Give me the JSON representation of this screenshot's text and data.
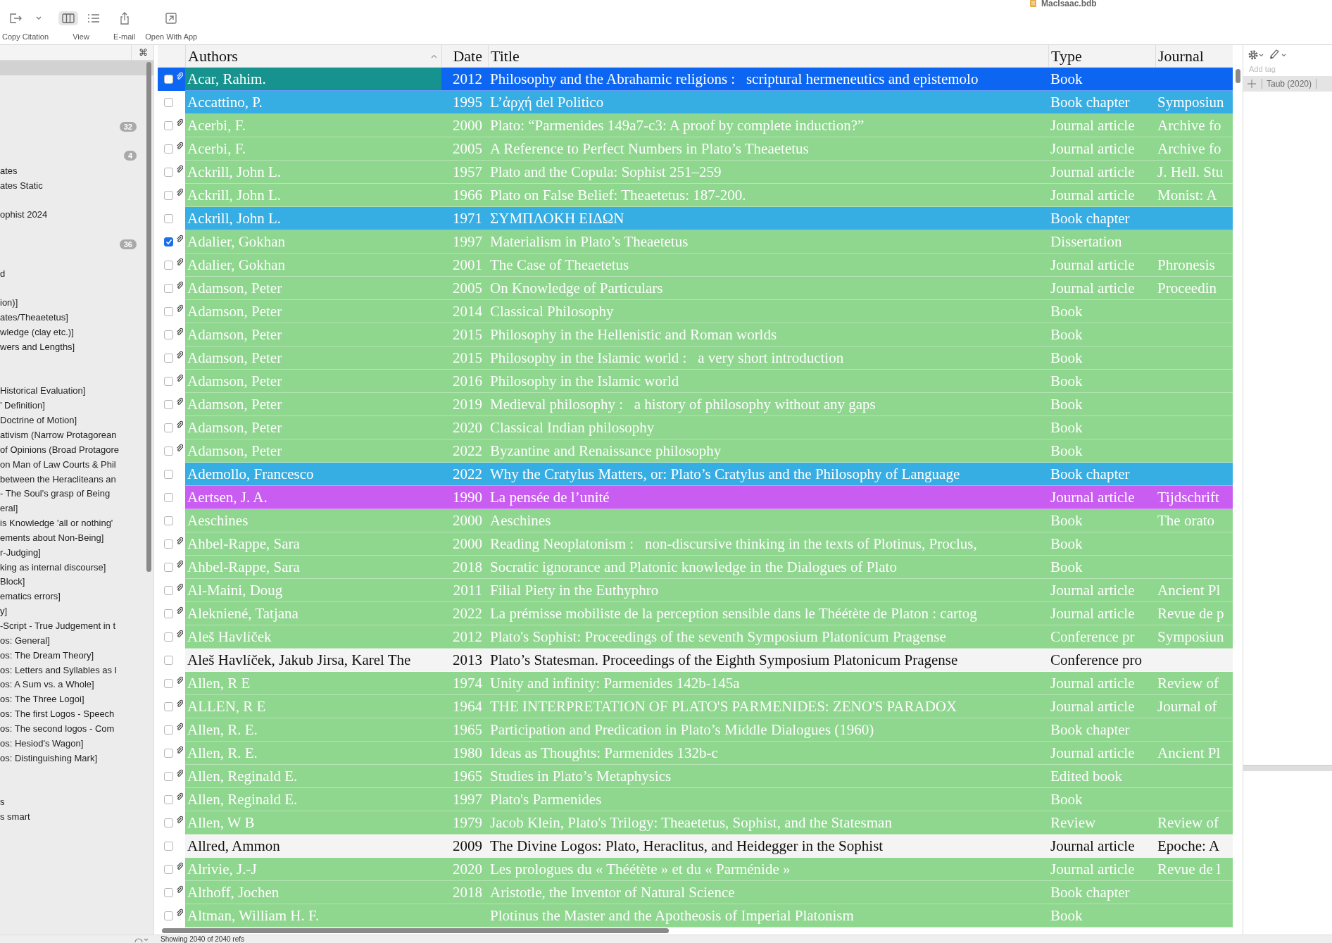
{
  "window": {
    "title": "MacIsaac.bdb"
  },
  "toolbar": [
    {
      "label": "Copy Citation",
      "icons": [
        {
          "kind": "export",
          "selected": false
        },
        {
          "kind": "chevron",
          "selected": false
        }
      ]
    },
    {
      "label": "View",
      "icons": [
        {
          "kind": "columns",
          "selected": true
        },
        {
          "kind": "list",
          "selected": false
        }
      ]
    },
    {
      "label": "E-mail",
      "icons": [
        {
          "kind": "share",
          "selected": false
        }
      ]
    },
    {
      "label": "Open With App",
      "icons": [
        {
          "kind": "external",
          "selected": false
        }
      ]
    }
  ],
  "sidebar": {
    "shortcut": "⌘",
    "items": [
      {
        "selected": true
      },
      {
        "selected": false
      },
      {
        "selected": false
      },
      {
        "selected": false
      },
      {
        "selected": false,
        "badge": "32"
      },
      {
        "selected": false
      },
      {
        "selected": false,
        "badge": "4"
      },
      {
        "selected": false,
        "label": "ates"
      },
      {
        "selected": false,
        "label": "ates Static"
      },
      {
        "selected": false
      },
      {
        "selected": false,
        "label": "ophist 2024"
      },
      {
        "selected": false
      },
      {
        "selected": false,
        "badge": "36"
      },
      {
        "selected": false
      },
      {
        "selected": false,
        "label": "d"
      },
      {
        "selected": false
      },
      {
        "selected": false,
        "label": "ion)]"
      },
      {
        "selected": false,
        "label": "ates/Theaetetus]"
      },
      {
        "selected": false,
        "label": "wledge (clay etc.)]"
      },
      {
        "selected": false,
        "label": "wers and Lengths]"
      },
      {
        "selected": false
      },
      {
        "selected": false
      },
      {
        "selected": false,
        "label": "Historical Evaluation]"
      },
      {
        "selected": false,
        "label": "’ Definition]"
      },
      {
        "selected": false,
        "label": "Doctrine of Motion]"
      },
      {
        "selected": false,
        "label": "ativism (Narrow Protagorean"
      },
      {
        "selected": false,
        "label": "of Opinions (Broad Protagore"
      },
      {
        "selected": false,
        "label": "on Man of Law Courts & Phil"
      },
      {
        "selected": false,
        "label": "between the Heracliteans an"
      },
      {
        "selected": false,
        "label": "- The Soul's grasp of Being"
      },
      {
        "selected": false,
        "label": "eral]"
      },
      {
        "selected": false,
        "label": "is Knowledge 'all or nothing'"
      },
      {
        "selected": false,
        "label": "ements about Non-Being]"
      },
      {
        "selected": false,
        "label": "r-Judging]"
      },
      {
        "selected": false,
        "label": "king as internal discourse]"
      },
      {
        "selected": false,
        "label": "Block]"
      },
      {
        "selected": false,
        "label": "ematics errors]"
      },
      {
        "selected": false,
        "label": "y]"
      },
      {
        "selected": false,
        "label": "-Script - True Judgement in t"
      },
      {
        "selected": false,
        "label": "os: General]"
      },
      {
        "selected": false,
        "label": "os: The Dream Theory]"
      },
      {
        "selected": false,
        "label": "os: Letters and Syllables as I"
      },
      {
        "selected": false,
        "label": "os: A Sum vs. a Whole]"
      },
      {
        "selected": false,
        "label": "os: The Three Logoi]"
      },
      {
        "selected": false,
        "label": "os: The first Logos - Speech"
      },
      {
        "selected": false,
        "label": "os: The second logos - Com"
      },
      {
        "selected": false,
        "label": "os: Hesiod's Wagon]"
      },
      {
        "selected": false,
        "label": "os: Distinguishing Mark]"
      },
      {
        "selected": false
      },
      {
        "selected": false
      },
      {
        "selected": false,
        "label": "s"
      },
      {
        "selected": false,
        "label": "s smart"
      }
    ]
  },
  "table": {
    "columns": [
      {
        "label": "Authors",
        "sorted": true
      },
      {
        "label": "Date",
        "sorted": false
      },
      {
        "label": "Title",
        "sorted": false
      },
      {
        "label": "Type",
        "sorted": false
      },
      {
        "label": "Journal",
        "sorted": false
      }
    ],
    "rows": [
      {
        "selected": true,
        "checked": false,
        "attachment": true,
        "color": "#16928f",
        "authors": "Acar, Rahim.",
        "date": "2012",
        "title": "Philosophy and the Abrahamic religions :   scriptural hermeneutics and epistemolo",
        "type": "Book"
      },
      {
        "selected": false,
        "checked": false,
        "attachment": false,
        "color": "#36ade3",
        "authors": "Accattino, P.",
        "date": "1995",
        "title": "L’ἀρχή del Politico",
        "type": "Book chapter",
        "journal": "Symposiun"
      },
      {
        "selected": false,
        "checked": false,
        "attachment": true,
        "color": "#8fd68f",
        "authors": "Acerbi, F.",
        "date": "2000",
        "title": "Plato: “Parmenides 149a7-c3: A proof by complete induction?”",
        "type": "Journal article",
        "journal": "Archive fo"
      },
      {
        "selected": false,
        "checked": false,
        "attachment": true,
        "color": "#8fd68f",
        "authors": "Acerbi, F.",
        "date": "2005",
        "title": "A Reference to Perfect Numbers in Plato’s Theaetetus",
        "type": "Journal article",
        "journal": "Archive fo"
      },
      {
        "selected": false,
        "checked": false,
        "attachment": true,
        "color": "#8fd68f",
        "authors": "Ackrill, John L.",
        "date": "1957",
        "title": "Plato and the Copula: Sophist 251–259",
        "type": "Journal article",
        "journal": "J. Hell. Stu"
      },
      {
        "selected": false,
        "checked": false,
        "attachment": true,
        "color": "#8fd68f",
        "authors": "Ackrill, John L.",
        "date": "1966",
        "title": "Plato on False Belief: Theaetetus: 187-200.",
        "type": "Journal article",
        "journal": "Monist: A"
      },
      {
        "selected": false,
        "checked": false,
        "attachment": false,
        "color": "#36ade3",
        "authors": "Ackrill, John L.",
        "date": "1971",
        "title": "ΣΥΜΠΛΟΚΗ ΕΙΔΩΝ",
        "type": "Book chapter"
      },
      {
        "selected": false,
        "checked": true,
        "attachment": true,
        "color": "#8fd68f",
        "authors": "Adalier, Gokhan",
        "date": "1997",
        "title": "Materialism in Plato’s Theaetetus",
        "type": "Dissertation"
      },
      {
        "selected": false,
        "checked": false,
        "attachment": true,
        "color": "#8fd68f",
        "authors": "Adalier, Gokhan",
        "date": "2001",
        "title": "The Case of Theaetetus",
        "type": "Journal article",
        "journal": "Phronesis"
      },
      {
        "selected": false,
        "checked": false,
        "attachment": true,
        "color": "#8fd68f",
        "authors": "Adamson, Peter",
        "date": "2005",
        "title": "On Knowledge of Particulars",
        "type": "Journal article",
        "journal": "Proceedin"
      },
      {
        "selected": false,
        "checked": false,
        "attachment": true,
        "color": "#8fd68f",
        "authors": "Adamson, Peter",
        "date": "2014",
        "title": "Classical Philosophy",
        "type": "Book"
      },
      {
        "selected": false,
        "checked": false,
        "attachment": true,
        "color": "#8fd68f",
        "authors": "Adamson, Peter",
        "date": "2015",
        "title": "Philosophy in the Hellenistic and Roman worlds",
        "type": "Book"
      },
      {
        "selected": false,
        "checked": false,
        "attachment": true,
        "color": "#8fd68f",
        "authors": "Adamson, Peter",
        "date": "2015",
        "title": "Philosophy in the Islamic world :   a very short introduction",
        "type": "Book"
      },
      {
        "selected": false,
        "checked": false,
        "attachment": true,
        "color": "#8fd68f",
        "authors": "Adamson, Peter",
        "date": "2016",
        "title": "Philosophy in the Islamic world",
        "type": "Book"
      },
      {
        "selected": false,
        "checked": false,
        "attachment": true,
        "color": "#8fd68f",
        "authors": "Adamson, Peter",
        "date": "2019",
        "title": "Medieval philosophy :   a history of philosophy without any gaps",
        "type": "Book"
      },
      {
        "selected": false,
        "checked": false,
        "attachment": true,
        "color": "#8fd68f",
        "authors": "Adamson, Peter",
        "date": "2020",
        "title": "Classical Indian philosophy",
        "type": "Book"
      },
      {
        "selected": false,
        "checked": false,
        "attachment": true,
        "color": "#8fd68f",
        "authors": "Adamson, Peter",
        "date": "2022",
        "title": "Byzantine and Renaissance philosophy",
        "type": "Book"
      },
      {
        "selected": false,
        "checked": false,
        "attachment": false,
        "color": "#36ade3",
        "authors": "Ademollo, Francesco",
        "date": "2022",
        "title": "Why the Cratylus Matters, or: Plato’s Cratylus and the Philosophy of Language",
        "type": "Book chapter"
      },
      {
        "selected": false,
        "checked": false,
        "attachment": false,
        "color": "#c95df2",
        "authors": "Aertsen, J. A.",
        "date": "1990",
        "title": "La pensée de l’unité",
        "type": "Journal article",
        "journal": "Tijdschrift"
      },
      {
        "selected": false,
        "checked": false,
        "attachment": false,
        "color": "#8fd68f",
        "authors": "Aeschines",
        "date": "2000",
        "title": "Aeschines",
        "type": "Book",
        "journal": "The orato"
      },
      {
        "selected": false,
        "checked": false,
        "attachment": true,
        "color": "#8fd68f",
        "authors": "Ahbel-Rappe, Sara",
        "date": "2000",
        "title": "Reading Neoplatonism :   non-discursive thinking in the texts of Plotinus, Proclus,",
        "type": "Book"
      },
      {
        "selected": false,
        "checked": false,
        "attachment": true,
        "color": "#8fd68f",
        "authors": "Ahbel-Rappe, Sara",
        "date": "2018",
        "title": "Socratic ignorance and Platonic knowledge in the Dialogues of Plato",
        "type": "Book"
      },
      {
        "selected": false,
        "checked": false,
        "attachment": true,
        "color": "#8fd68f",
        "authors": "Al-Maini, Doug",
        "date": "2011",
        "title": "Filial Piety in the Euthyphro",
        "type": "Journal article",
        "journal": "Ancient Pl"
      },
      {
        "selected": false,
        "checked": false,
        "attachment": true,
        "color": "#8fd68f",
        "authors": "Alekniené, Tatjana",
        "date": "2022",
        "title": "La prémisse mobiliste de la perception sensible dans le Théétète de Platon : cartog",
        "type": "Journal article",
        "journal": "Revue de p"
      },
      {
        "selected": false,
        "checked": false,
        "attachment": true,
        "color": "#8fd68f",
        "authors": "Aleš Havlíček",
        "date": "2012",
        "title": "Plato's Sophist: Proceedings of the seventh Symposium Platonicum Pragense",
        "type": "Conference pr",
        "journal": "Symposiun"
      },
      {
        "selected": false,
        "checked": false,
        "attachment": false,
        "color": "#f4f4f4",
        "authors": "Aleš Havlíček, Jakub Jirsa, Karel The",
        "date": "2013",
        "title": "Plato’s Statesman. Proceedings of the Eighth Symposium Platonicum Pragense",
        "type": "Conference pro"
      },
      {
        "selected": false,
        "checked": false,
        "attachment": true,
        "color": "#8fd68f",
        "authors": "Allen, R E",
        "date": "1974",
        "title": "Unity and infinity: Parmenides 142b-145a",
        "type": "Journal article",
        "journal": "Review of"
      },
      {
        "selected": false,
        "checked": false,
        "attachment": true,
        "color": "#8fd68f",
        "authors": "ALLEN, R E",
        "date": "1964",
        "title": "THE INTERPRETATION OF PLATO'S PARMENIDES: ZENO'S PARADOX",
        "type": "Journal article",
        "journal": "Journal of"
      },
      {
        "selected": false,
        "checked": false,
        "attachment": true,
        "color": "#8fd68f",
        "authors": "Allen, R. E.",
        "date": "1965",
        "title": "Participation and Predication in Plato’s Middle Dialogues (1960)",
        "type": "Book chapter"
      },
      {
        "selected": false,
        "checked": false,
        "attachment": true,
        "color": "#8fd68f",
        "authors": "Allen, R. E.",
        "date": "1980",
        "title": "Ideas as Thoughts: Parmenides 132b-c",
        "type": "Journal article",
        "journal": "Ancient Pl"
      },
      {
        "selected": false,
        "checked": false,
        "attachment": true,
        "color": "#8fd68f",
        "authors": "Allen, Reginald E.",
        "date": "1965",
        "title": "Studies in Plato’s Metaphysics",
        "type": "Edited book"
      },
      {
        "selected": false,
        "checked": false,
        "attachment": true,
        "color": "#8fd68f",
        "authors": "Allen, Reginald E.",
        "date": "1997",
        "title": "Plato's Parmenides",
        "type": "Book"
      },
      {
        "selected": false,
        "checked": false,
        "attachment": true,
        "color": "#8fd68f",
        "authors": "Allen, W B",
        "date": "1979",
        "title": "Jacob Klein, Plato's Trilogy: Theaetetus, Sophist, and the Statesman",
        "type": "Review",
        "journal": "Review of"
      },
      {
        "selected": false,
        "checked": false,
        "attachment": false,
        "color": "#f4f4f4",
        "authors": "Allred, Ammon",
        "date": "2009",
        "title": "The Divine Logos: Plato, Heraclitus, and Heidegger in the Sophist",
        "type": "Journal article",
        "journal": "Epoche: A"
      },
      {
        "selected": false,
        "checked": false,
        "attachment": true,
        "color": "#8fd68f",
        "authors": "Alrivie, J.-J",
        "date": "2020",
        "title": "Les prologues du « Théétète » et du « Parménide »",
        "type": "Journal article",
        "journal": "Revue de l"
      },
      {
        "selected": false,
        "checked": false,
        "attachment": true,
        "color": "#8fd68f",
        "authors": "Althoff, Jochen",
        "date": "2018",
        "title": "Aristotle, the Inventor of Natural Science",
        "type": "Book chapter"
      },
      {
        "selected": false,
        "checked": false,
        "attachment": true,
        "color": "#8fd68f",
        "authors": "Altman, William H. F.",
        "title": "Plotinus the Master and the Apotheosis of Imperial Platonism",
        "type": "Book"
      }
    ]
  },
  "inspector": {
    "tag_placeholder": "Add tag",
    "tags": [
      "Taub (2020)"
    ]
  },
  "status_bar": {
    "text": "Showing 2040 of 2040 refs"
  }
}
